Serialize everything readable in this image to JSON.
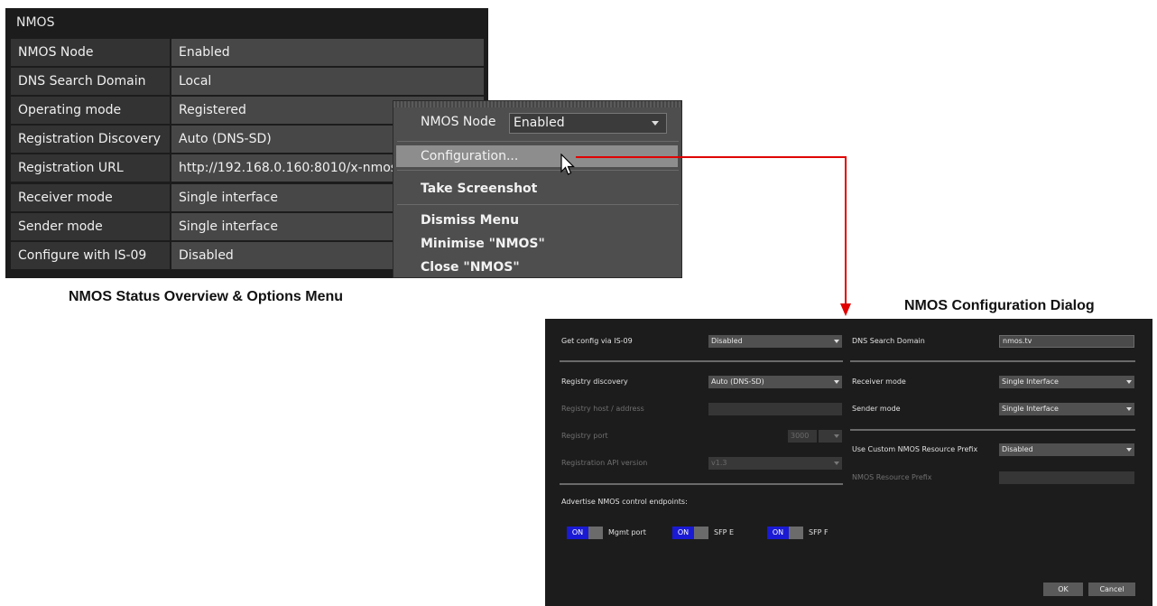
{
  "status_panel": {
    "title": "NMOS",
    "rows": [
      {
        "label": "NMOS Node",
        "value": "Enabled"
      },
      {
        "label": "DNS Search Domain",
        "value": "Local"
      },
      {
        "label": "Operating mode",
        "value": "Registered"
      },
      {
        "label": "Registration Discovery",
        "value": "Auto (DNS-SD)"
      },
      {
        "label": "Registration URL",
        "value": "http://192.168.0.160:8010/x-nmos/"
      },
      {
        "label": "Receiver mode",
        "value": "Single interface"
      },
      {
        "label": "Sender mode",
        "value": "Single interface"
      },
      {
        "label": "Configure with IS-09",
        "value": "Disabled"
      }
    ]
  },
  "context_menu": {
    "node_label": "NMOS Node",
    "node_value": "Enabled",
    "items": [
      "Configuration...",
      "Take Screenshot",
      "Dismiss Menu",
      "Minimise \"NMOS\"",
      "Close \"NMOS\""
    ]
  },
  "captions": {
    "left": "NMOS Status Overview & Options Menu",
    "right": "NMOS Configuration Dialog"
  },
  "config_dialog": {
    "get_config_label": "Get config via IS-09",
    "get_config_value": "Disabled",
    "registry_discovery_label": "Registry discovery",
    "registry_discovery_value": "Auto (DNS-SD)",
    "registry_host_label": "Registry host / address",
    "registry_host_value": "",
    "registry_port_label": "Registry port",
    "registry_port_value": "3000",
    "registration_api_label": "Registration API version",
    "registration_api_value": "v1.3",
    "advertise_label": "Advertise NMOS control endpoints:",
    "toggles": [
      {
        "state": "ON",
        "label": "Mgmt port"
      },
      {
        "state": "ON",
        "label": "SFP E"
      },
      {
        "state": "ON",
        "label": "SFP F"
      }
    ],
    "dns_label": "DNS Search Domain",
    "dns_value": "nmos.tv",
    "receiver_mode_label": "Receiver mode",
    "receiver_mode_value": "Single Interface",
    "sender_mode_label": "Sender mode",
    "sender_mode_value": "Single Interface",
    "custom_prefix_label": "Use Custom NMOS Resource Prefix",
    "custom_prefix_value": "Disabled",
    "resource_prefix_label": "NMOS Resource Prefix",
    "resource_prefix_value": "",
    "ok_label": "OK",
    "cancel_label": "Cancel"
  },
  "colors": {
    "arrow": "#e00000",
    "toggle_on": "#1a1ad4"
  }
}
